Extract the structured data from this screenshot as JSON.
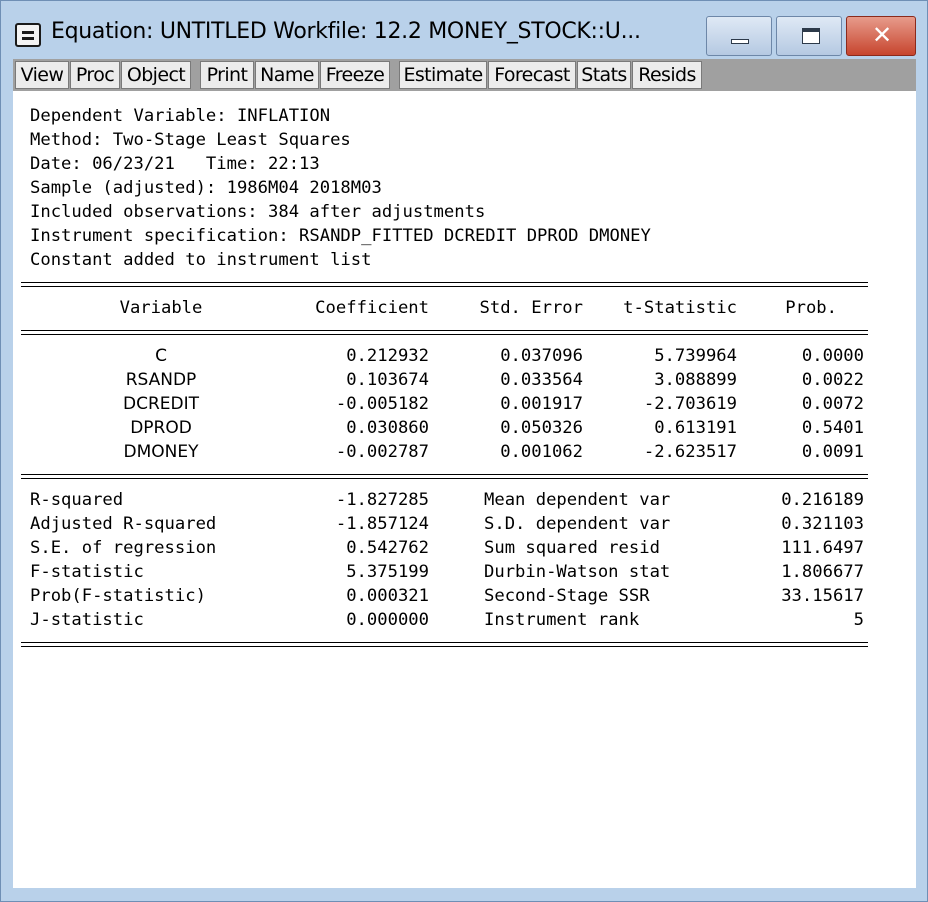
{
  "window": {
    "title": "Equation: UNTITLED   Workfile: 12.2 MONEY_STOCK::U...",
    "close_symbol": "✕"
  },
  "toolbar": {
    "buttons": [
      "View",
      "Proc",
      "Object",
      "Print",
      "Name",
      "Freeze",
      "Estimate",
      "Forecast",
      "Stats",
      "Resids"
    ]
  },
  "header": {
    "lines": [
      "Dependent Variable: INFLATION",
      "Method: Two-Stage Least Squares",
      "Date: 06/23/21   Time: 22:13",
      "Sample (adjusted): 1986M04 2018M03",
      "Included observations: 384 after adjustments",
      "Instrument specification: RSANDP_FITTED DCREDIT DPROD DMONEY",
      "Constant added to instrument list"
    ]
  },
  "coef_table": {
    "columns": [
      "Variable",
      "Coefficient",
      "Std. Error",
      "t-Statistic",
      "Prob."
    ],
    "rows": [
      [
        "C",
        "0.212932",
        "0.037096",
        "5.739964",
        "0.0000"
      ],
      [
        "RSANDP",
        "0.103674",
        "0.033564",
        "3.088899",
        "0.0022"
      ],
      [
        "DCREDIT",
        "-0.005182",
        "0.001917",
        "-2.703619",
        "0.0072"
      ],
      [
        "DPROD",
        "0.030860",
        "0.050326",
        "0.613191",
        "0.5401"
      ],
      [
        "DMONEY",
        "-0.002787",
        "0.001062",
        "-2.623517",
        "0.0091"
      ]
    ]
  },
  "stats": {
    "rows": [
      [
        "R-squared",
        "-1.827285",
        "Mean dependent var",
        "0.216189"
      ],
      [
        "Adjusted R-squared",
        "-1.857124",
        "S.D. dependent var",
        "0.321103"
      ],
      [
        "S.E. of regression",
        "0.542762",
        "Sum squared resid",
        "111.6497"
      ],
      [
        "F-statistic",
        "5.375199",
        "Durbin-Watson stat",
        "1.806677"
      ],
      [
        "Prob(F-statistic)",
        "0.000321",
        "Second-Stage SSR",
        "33.15617"
      ],
      [
        "J-statistic",
        "0.000000",
        "Instrument rank",
        "5"
      ]
    ]
  }
}
